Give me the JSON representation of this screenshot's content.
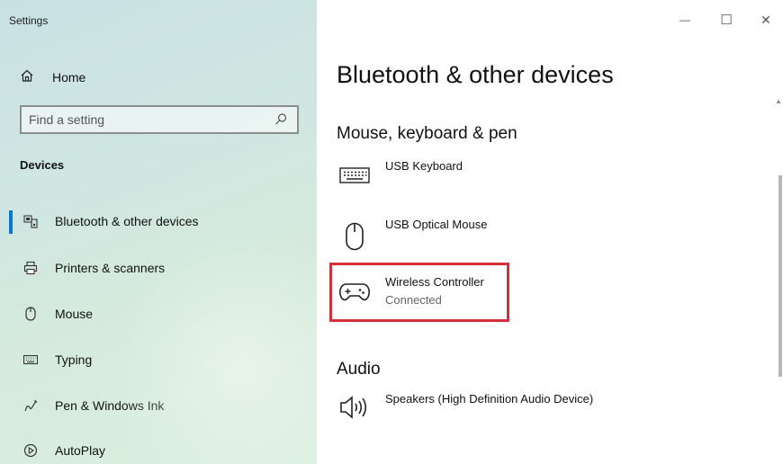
{
  "app": {
    "title": "Settings"
  },
  "sidebar": {
    "home_label": "Home",
    "search_placeholder": "Find a setting",
    "section_label": "Devices",
    "items": [
      {
        "label": "Bluetooth & other devices",
        "icon": "bluetooth-devices-icon",
        "selected": true
      },
      {
        "label": "Printers & scanners",
        "icon": "printer-icon",
        "selected": false
      },
      {
        "label": "Mouse",
        "icon": "mouse-icon",
        "selected": false
      },
      {
        "label": "Typing",
        "icon": "keyboard-icon",
        "selected": false
      },
      {
        "label": "Pen & Windows Ink",
        "icon": "pen-icon",
        "selected": false
      },
      {
        "label": "AutoPlay",
        "icon": "autoplay-icon",
        "selected": false
      }
    ]
  },
  "window_controls": {
    "minimize": "—",
    "maximize": "☐",
    "close": "✕"
  },
  "main": {
    "title": "Bluetooth & other devices",
    "groups": [
      {
        "title": "Mouse, keyboard & pen",
        "devices": [
          {
            "name": "USB Keyboard",
            "status": "",
            "icon": "keyboard-icon"
          },
          {
            "name": "USB Optical Mouse",
            "status": "",
            "icon": "mouse-icon"
          },
          {
            "name": "Wireless Controller",
            "status": "Connected",
            "icon": "gamepad-icon",
            "highlighted": true
          }
        ]
      },
      {
        "title": "Audio",
        "devices": [
          {
            "name": "Speakers (High Definition Audio Device)",
            "status": "",
            "icon": "speaker-icon"
          }
        ]
      }
    ]
  },
  "colors": {
    "accent": "#0078d4",
    "highlight_border": "#d6303a"
  }
}
